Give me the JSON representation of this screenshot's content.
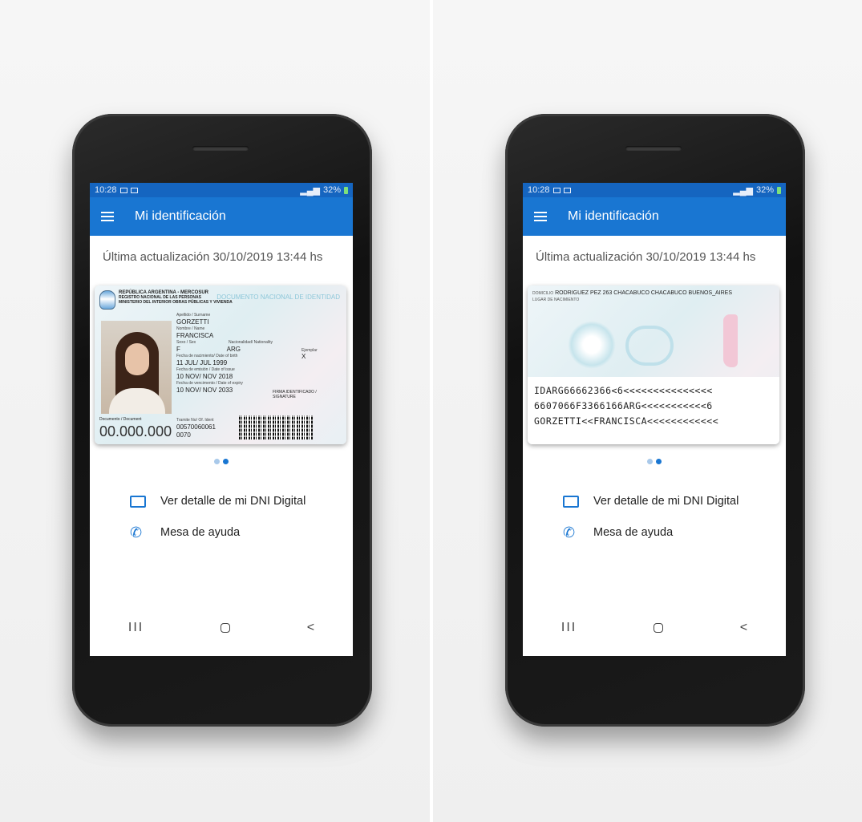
{
  "status": {
    "time": "10:28",
    "battery": "32%"
  },
  "app": {
    "title": "Mi identificación"
  },
  "updated": "Última actualización 30/10/2019 13:44 hs",
  "card_front": {
    "country_line1": "REPÚBLICA ARGENTINA - MERCOSUR",
    "country_line2": "REGISTRO NACIONAL DE LAS PERSONAS",
    "country_line3": "MINISTERIO DEL INTERIOR OBRAS PÚBLICAS Y VIVIENDA",
    "doc_type": "DOCUMENTO NACIONAL DE IDENTIDAD",
    "surname_label": "Apellido / Surname",
    "surname": "GORZETTI",
    "name_label": "Nombre / Name",
    "name": "FRANCISCA",
    "sex_label": "Sexo / Sex",
    "sex": "F",
    "nationality_label": "Nacionalidad/ Nationality",
    "nationality": "ARG",
    "copy_label": "Ejemplar",
    "copy": "X",
    "birth_label": "Fecha de nacimiento/ Date of birth",
    "birth": "11 JUL/ JUL 1999",
    "issue_label": "Fecha de emisión / Date of issue",
    "issue": "10 NOV/ NOV 2018",
    "expiry_label": "Fecha de vencimento / Date of expiry",
    "expiry": "10 NOV/ NOV 2033",
    "signature_label": "FIRMA IDENTIFICADO / SIGNATURE",
    "document_label": "Documento / Document",
    "document_number": "00.000.000",
    "tramite_label": "Tramite No/ Of. Ident",
    "tramite_number": "00570060061",
    "tramite_extra": "0070"
  },
  "card_back": {
    "address_label": "DOMICILIO",
    "address": "RODRIGUEZ PEZ 263 CHACABUCO CHACABUCO BUENOS_AIRES",
    "birthplace_label": "LUGAR DE NACIMIENTO",
    "mrz": [
      "IDARG66662366<6<<<<<<<<<<<<<<<",
      "6607066F3366166ARG<<<<<<<<<<<6",
      "GORZETTI<<FRANCISCA<<<<<<<<<<<<"
    ]
  },
  "actions": {
    "detail": "Ver detalle de mi DNI Digital",
    "help": "Mesa de ayuda"
  },
  "nav": {
    "recent": "III",
    "back": "<"
  },
  "colors": {
    "primary": "#1976d2",
    "statusbar": "#1565c0",
    "dot_inactive": "#a9c9ea"
  }
}
